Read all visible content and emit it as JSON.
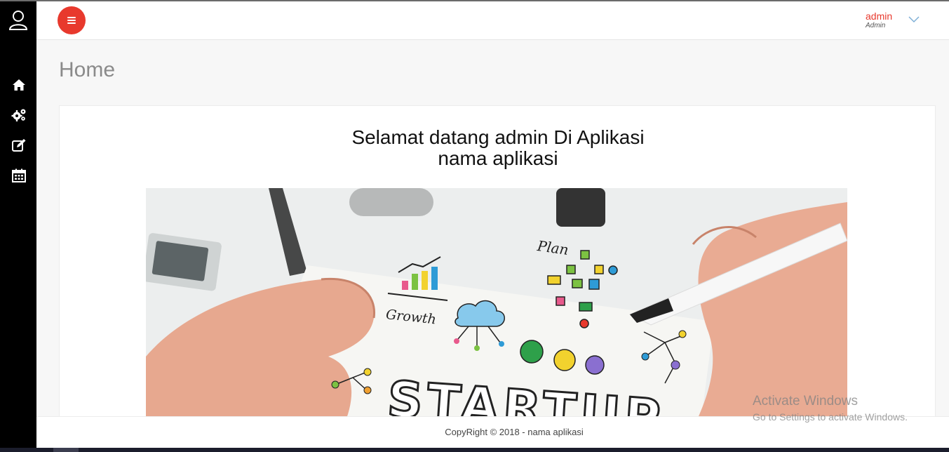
{
  "header": {
    "user_name": "admin",
    "user_role": "Admin"
  },
  "sidebar": {
    "items": [
      {
        "icon": "home-icon"
      },
      {
        "icon": "gears-icon"
      },
      {
        "icon": "edit-icon"
      },
      {
        "icon": "calendar-icon"
      }
    ]
  },
  "main": {
    "page_title": "Home",
    "welcome_line1": "Selamat datang admin Di Aplikasi",
    "welcome_line2": "nama aplikasi",
    "banner": {
      "labels": [
        "Plan",
        "Growth",
        "STARTUP"
      ]
    }
  },
  "footer": {
    "text": "CopyRight © 2018 - nama aplikasi"
  },
  "watermark": {
    "line1": "Activate Windows",
    "line2": "Go to Settings to activate Windows."
  },
  "colors": {
    "accent": "#e8392d",
    "sidebar": "#000000"
  }
}
